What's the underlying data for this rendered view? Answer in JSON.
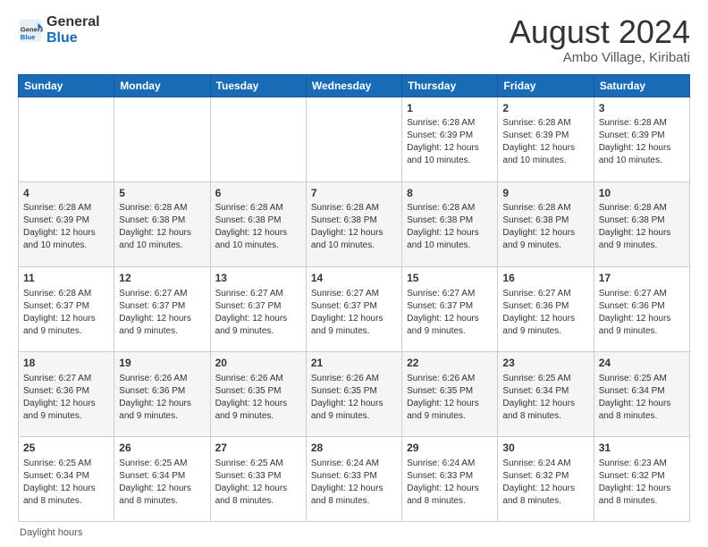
{
  "logo": {
    "line1": "General",
    "line2": "Blue"
  },
  "title": "August 2024",
  "subtitle": "Ambo Village, Kiribati",
  "days_of_week": [
    "Sunday",
    "Monday",
    "Tuesday",
    "Wednesday",
    "Thursday",
    "Friday",
    "Saturday"
  ],
  "footer_note": "Daylight hours",
  "weeks": [
    [
      {
        "day": "",
        "content": ""
      },
      {
        "day": "",
        "content": ""
      },
      {
        "day": "",
        "content": ""
      },
      {
        "day": "",
        "content": ""
      },
      {
        "day": "1",
        "content": "Sunrise: 6:28 AM\nSunset: 6:39 PM\nDaylight: 12 hours and 10 minutes."
      },
      {
        "day": "2",
        "content": "Sunrise: 6:28 AM\nSunset: 6:39 PM\nDaylight: 12 hours and 10 minutes."
      },
      {
        "day": "3",
        "content": "Sunrise: 6:28 AM\nSunset: 6:39 PM\nDaylight: 12 hours and 10 minutes."
      }
    ],
    [
      {
        "day": "4",
        "content": "Sunrise: 6:28 AM\nSunset: 6:39 PM\nDaylight: 12 hours and 10 minutes."
      },
      {
        "day": "5",
        "content": "Sunrise: 6:28 AM\nSunset: 6:38 PM\nDaylight: 12 hours and 10 minutes."
      },
      {
        "day": "6",
        "content": "Sunrise: 6:28 AM\nSunset: 6:38 PM\nDaylight: 12 hours and 10 minutes."
      },
      {
        "day": "7",
        "content": "Sunrise: 6:28 AM\nSunset: 6:38 PM\nDaylight: 12 hours and 10 minutes."
      },
      {
        "day": "8",
        "content": "Sunrise: 6:28 AM\nSunset: 6:38 PM\nDaylight: 12 hours and 10 minutes."
      },
      {
        "day": "9",
        "content": "Sunrise: 6:28 AM\nSunset: 6:38 PM\nDaylight: 12 hours and 9 minutes."
      },
      {
        "day": "10",
        "content": "Sunrise: 6:28 AM\nSunset: 6:38 PM\nDaylight: 12 hours and 9 minutes."
      }
    ],
    [
      {
        "day": "11",
        "content": "Sunrise: 6:28 AM\nSunset: 6:37 PM\nDaylight: 12 hours and 9 minutes."
      },
      {
        "day": "12",
        "content": "Sunrise: 6:27 AM\nSunset: 6:37 PM\nDaylight: 12 hours and 9 minutes."
      },
      {
        "day": "13",
        "content": "Sunrise: 6:27 AM\nSunset: 6:37 PM\nDaylight: 12 hours and 9 minutes."
      },
      {
        "day": "14",
        "content": "Sunrise: 6:27 AM\nSunset: 6:37 PM\nDaylight: 12 hours and 9 minutes."
      },
      {
        "day": "15",
        "content": "Sunrise: 6:27 AM\nSunset: 6:37 PM\nDaylight: 12 hours and 9 minutes."
      },
      {
        "day": "16",
        "content": "Sunrise: 6:27 AM\nSunset: 6:36 PM\nDaylight: 12 hours and 9 minutes."
      },
      {
        "day": "17",
        "content": "Sunrise: 6:27 AM\nSunset: 6:36 PM\nDaylight: 12 hours and 9 minutes."
      }
    ],
    [
      {
        "day": "18",
        "content": "Sunrise: 6:27 AM\nSunset: 6:36 PM\nDaylight: 12 hours and 9 minutes."
      },
      {
        "day": "19",
        "content": "Sunrise: 6:26 AM\nSunset: 6:36 PM\nDaylight: 12 hours and 9 minutes."
      },
      {
        "day": "20",
        "content": "Sunrise: 6:26 AM\nSunset: 6:35 PM\nDaylight: 12 hours and 9 minutes."
      },
      {
        "day": "21",
        "content": "Sunrise: 6:26 AM\nSunset: 6:35 PM\nDaylight: 12 hours and 9 minutes."
      },
      {
        "day": "22",
        "content": "Sunrise: 6:26 AM\nSunset: 6:35 PM\nDaylight: 12 hours and 9 minutes."
      },
      {
        "day": "23",
        "content": "Sunrise: 6:25 AM\nSunset: 6:34 PM\nDaylight: 12 hours and 8 minutes."
      },
      {
        "day": "24",
        "content": "Sunrise: 6:25 AM\nSunset: 6:34 PM\nDaylight: 12 hours and 8 minutes."
      }
    ],
    [
      {
        "day": "25",
        "content": "Sunrise: 6:25 AM\nSunset: 6:34 PM\nDaylight: 12 hours and 8 minutes."
      },
      {
        "day": "26",
        "content": "Sunrise: 6:25 AM\nSunset: 6:34 PM\nDaylight: 12 hours and 8 minutes."
      },
      {
        "day": "27",
        "content": "Sunrise: 6:25 AM\nSunset: 6:33 PM\nDaylight: 12 hours and 8 minutes."
      },
      {
        "day": "28",
        "content": "Sunrise: 6:24 AM\nSunset: 6:33 PM\nDaylight: 12 hours and 8 minutes."
      },
      {
        "day": "29",
        "content": "Sunrise: 6:24 AM\nSunset: 6:33 PM\nDaylight: 12 hours and 8 minutes."
      },
      {
        "day": "30",
        "content": "Sunrise: 6:24 AM\nSunset: 6:32 PM\nDaylight: 12 hours and 8 minutes."
      },
      {
        "day": "31",
        "content": "Sunrise: 6:23 AM\nSunset: 6:32 PM\nDaylight: 12 hours and 8 minutes."
      }
    ]
  ]
}
